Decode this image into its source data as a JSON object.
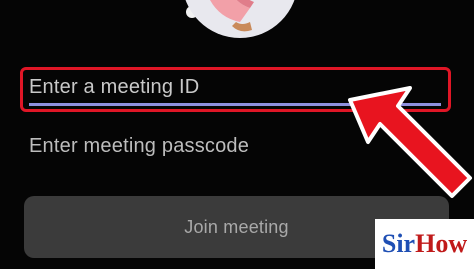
{
  "meeting": {
    "id_placeholder": "Enter a meeting ID",
    "passcode_placeholder": "Enter meeting passcode",
    "join_label": "Join meeting"
  },
  "icons": {
    "illustration": "person-illustration",
    "arrow": "red-arrow-icon"
  },
  "watermark": {
    "sir": "Sir",
    "how": "How"
  },
  "colors": {
    "background": "#050505",
    "field_underline": "#8f90df",
    "highlight": "#e01626",
    "button": "#3b3b3b",
    "logo_sir": "#1f4fb4",
    "logo_how": "#c01a1a"
  }
}
